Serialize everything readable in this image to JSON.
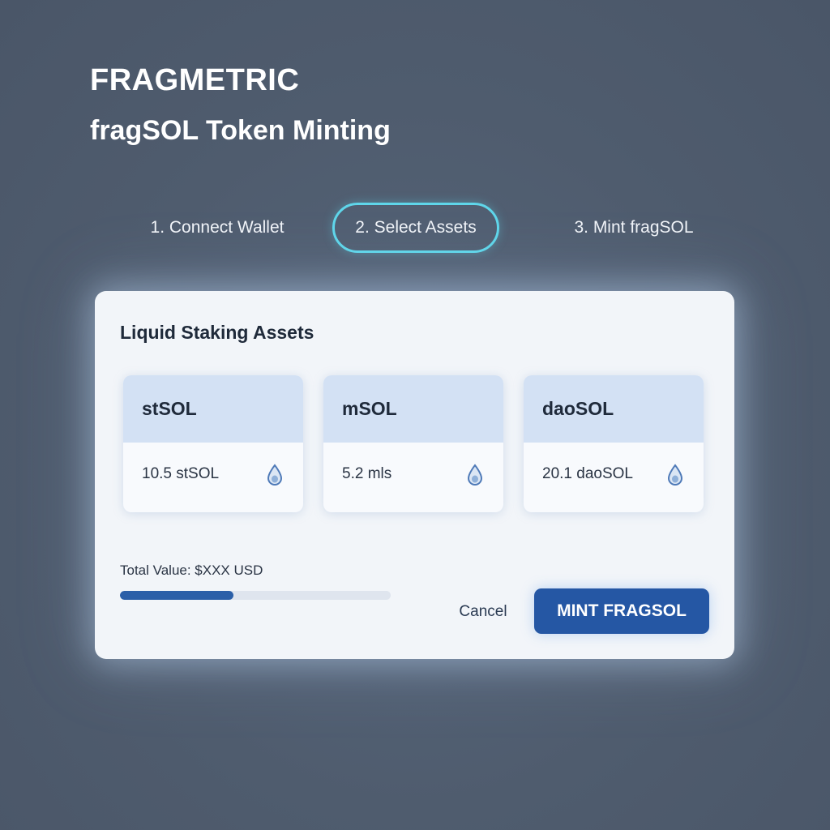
{
  "header": {
    "brand": "FRAGMETRIC",
    "subtitle": "fragSOL Token Minting"
  },
  "steps": [
    {
      "label": "1. Connect Wallet",
      "active": false
    },
    {
      "label": "2. Select Assets",
      "active": true
    },
    {
      "label": "3. Mint fragSOL",
      "active": false
    }
  ],
  "panel": {
    "title": "Liquid Staking Assets",
    "assets": [
      {
        "name": "stSOL",
        "balance": "10.5 stSOL",
        "icon": "droplet-icon"
      },
      {
        "name": "mSOL",
        "balance": "5.2 mls",
        "icon": "droplet-icon"
      },
      {
        "name": "daoSOL",
        "balance": "20.1 daoSOL",
        "icon": "droplet-icon"
      }
    ],
    "total_label": "Total Value: $XXX USD",
    "progress_fraction": 0.42,
    "cancel_label": "Cancel",
    "mint_label": "MINT FRAGSOL"
  },
  "colors": {
    "background": "#4f5c6e",
    "accent": "#2557a4",
    "active_step_outline": "#5fd6ea",
    "card_header": "#d3e1f4"
  }
}
